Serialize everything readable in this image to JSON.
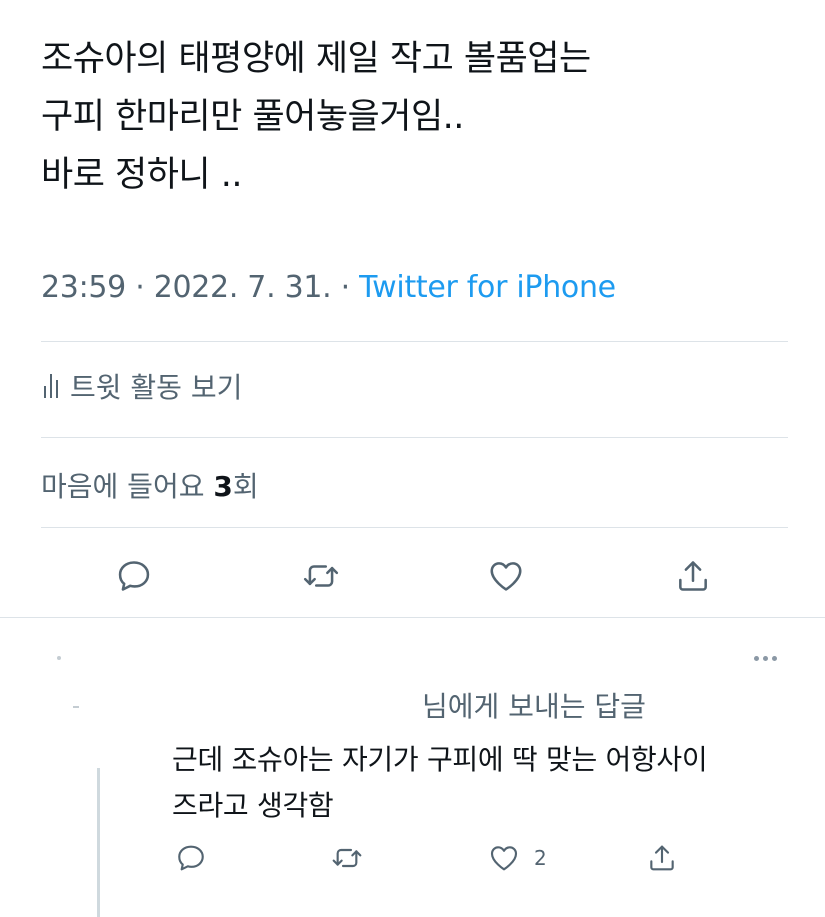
{
  "tweet": {
    "lines": [
      "조슈아의 태평양에 제일 작고 볼품업는",
      "구피 한마리만 풀어놓을거임..",
      "바로 정하니 .."
    ],
    "time": "23:59",
    "separator": " · ",
    "date": "2022. 7. 31.",
    "source": "Twitter for iPhone"
  },
  "activity": {
    "label": "트윗 활동 보기",
    "icon": "analytics-bars-icon"
  },
  "likes": {
    "prefix": "마음에 들어요 ",
    "count": "3",
    "suffix": "회"
  },
  "actions": [
    {
      "name": "reply",
      "icon": "comment-icon"
    },
    {
      "name": "retweet",
      "icon": "retweet-icon"
    },
    {
      "name": "like",
      "icon": "heart-icon"
    },
    {
      "name": "share",
      "icon": "share-icon"
    }
  ],
  "reply": {
    "reply_to": "님에게 보내는 답글",
    "lines": [
      "근데 조슈아는 자기가 구피에 딱 맞는 어항사이",
      "즈라고 생각함"
    ],
    "like_count": "2",
    "more_icon": "more-dots-icon"
  },
  "colors": {
    "text": "#0f1419",
    "secondary": "#536471",
    "accent": "#1d9bf0",
    "divider": "#dde3e8"
  }
}
